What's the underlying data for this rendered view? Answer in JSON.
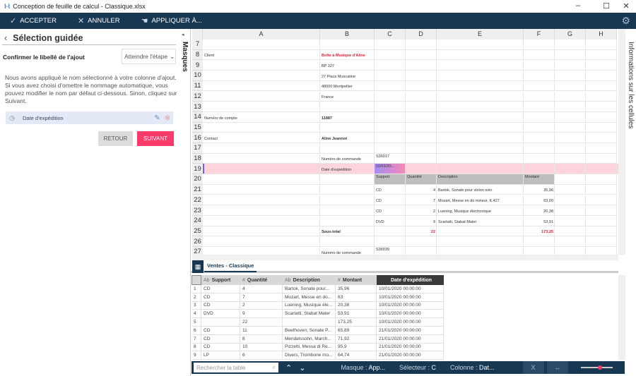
{
  "window": {
    "title": "Conception de feuille de calcul - Classique.xlsx",
    "minimize": "–",
    "maximize": "☐",
    "close": "✕"
  },
  "toolbar": {
    "accept": "ACCEPTER",
    "cancel": "ANNULER",
    "apply": "APPLIQUER À...",
    "icons": [
      "check-icon",
      "close-icon",
      "hand-icon",
      "gear-icon"
    ]
  },
  "panel": {
    "back": "‹",
    "title": "Sélection guidée",
    "step_label": "Confirmer le libellé de l'ajout",
    "step_select": "Atteindre l'étape",
    "description": "Nous avons appliqué le nom sélectionné à votre colonne d'ajout. Si vous avez choisi d'omettre le nommage automatique, vous pouvez modifier le nom par défaut ci-dessous. Sinon, cliquez sur Suivant.",
    "field_value": "Date d'expédition",
    "back_button": "RETOUR",
    "next_button": "SUIVANT",
    "accent": "#fc3b6b"
  },
  "masques_label": "Masques",
  "infos_label": "Informations sur les cellules",
  "sheet": {
    "columns": [
      "A",
      "B",
      "C",
      "D",
      "E",
      "F",
      "G",
      "H"
    ],
    "rows": [
      {
        "n": "7",
        "cells": {}
      },
      {
        "n": "8",
        "cells": {
          "A": "Client",
          "B": "Boîte à Musique d'Aline"
        }
      },
      {
        "n": "9",
        "cells": {
          "B": "BP 327"
        }
      },
      {
        "n": "10",
        "cells": {
          "B": "27 Place Muscatine"
        }
      },
      {
        "n": "11",
        "cells": {
          "B": "48000 Montpellier"
        }
      },
      {
        "n": "12",
        "cells": {
          "B": "France"
        }
      },
      {
        "n": "13",
        "cells": {}
      },
      {
        "n": "14",
        "cells": {
          "A": "Numéro de compte",
          "B": "11887"
        }
      },
      {
        "n": "15",
        "cells": {}
      },
      {
        "n": "16",
        "cells": {
          "A": "Contact",
          "B": "Aline Jeannot"
        }
      },
      {
        "n": "17",
        "cells": {}
      },
      {
        "n": "18",
        "cells": {
          "B": "Numéro de commande",
          "C": "S36017"
        }
      },
      {
        "n": "19",
        "cells": {
          "B": "Date d'expédition",
          "C": "10/01/20..."
        }
      },
      {
        "n": "20",
        "cells": {
          "C": "Support",
          "D": "Quantité",
          "E": "Description",
          "F": "Montant"
        }
      },
      {
        "n": "21",
        "cells": {
          "C": "CD",
          "D": "4",
          "E": "Bartok, Sonate pour violon solo",
          "F": "35,96"
        }
      },
      {
        "n": "22",
        "cells": {
          "C": "CD",
          "D": "7",
          "E": "Mozart, Messe en do mineur, K.427",
          "F": "63,00"
        }
      },
      {
        "n": "23",
        "cells": {
          "C": "CD",
          "D": "2",
          "E": "Luening, Musique électronique",
          "F": "20,38"
        }
      },
      {
        "n": "24",
        "cells": {
          "C": "DVD",
          "D": "9",
          "E": "Scarlatti, Stabat Mater",
          "F": "53,91"
        }
      },
      {
        "n": "25",
        "cells": {
          "B": "Sous-total",
          "D": "22",
          "F": "173,25"
        }
      },
      {
        "n": "26",
        "cells": {}
      },
      {
        "n": "27",
        "cells": {
          "B": "Numéro de commande",
          "C": "S36039"
        }
      }
    ],
    "selected_row": "19",
    "highlight_color": "#fdd4dc"
  },
  "tab": {
    "label": "Ventes - Classique"
  },
  "table": {
    "columns": [
      {
        "type": "Ab",
        "label": "Support"
      },
      {
        "type": "#",
        "label": "Quantité"
      },
      {
        "type": "Ab",
        "label": "Description"
      },
      {
        "type": "#",
        "label": "Montant"
      },
      {
        "type": "",
        "label": "Date d'expédition"
      }
    ],
    "rows": [
      [
        "1",
        "CD",
        "4",
        "Bartok, Sonate pour...",
        "35,96",
        "10/01/2020 00:00:00"
      ],
      [
        "2",
        "CD",
        "7",
        "Mozart, Messe en do...",
        "63",
        "10/01/2020 00:00:00"
      ],
      [
        "3",
        "CD",
        "2",
        "Luening, Musique éle...",
        "20,38",
        "10/01/2020 00:00:00"
      ],
      [
        "4",
        "DVD",
        "9",
        "Scarlatti, Stabat Mater",
        "53,91",
        "10/01/2020 00:00:00"
      ],
      [
        "5",
        "",
        "22",
        "",
        "173,25",
        "10/01/2020 00:00:00"
      ],
      [
        "6",
        "CD",
        "11",
        "Beethoven, Sonate P...",
        "65,89",
        "21/01/2020 00:00:00"
      ],
      [
        "7",
        "CD",
        "8",
        "Mendelssohn, March...",
        "71,92",
        "21/01/2020 00:00:00"
      ],
      [
        "8",
        "CD",
        "10",
        "Pizzetti, Messa di Re...",
        "95,9",
        "21/01/2020 00:00:00"
      ],
      [
        "9",
        "LP",
        "6",
        "Divers, Trombone mo...",
        "64,74",
        "21/01/2020 00:00:00"
      ]
    ]
  },
  "status": {
    "search_placeholder": "Rechercher la table",
    "mask_label": "Masque : ",
    "mask_value": "App...",
    "selector_label": "Sélecteur : ",
    "selector_value": "C",
    "column_label": "Colonne : ",
    "column_value": "Dat...",
    "zoom_level": 0.55
  }
}
